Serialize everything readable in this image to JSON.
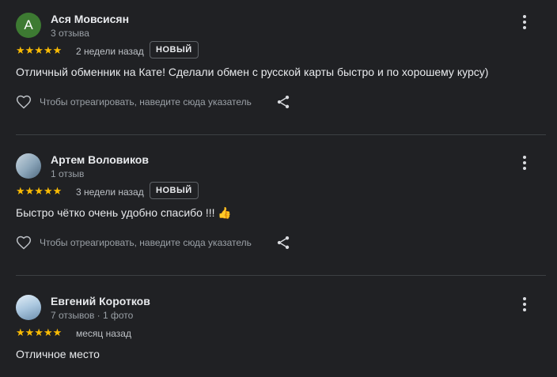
{
  "reviews": [
    {
      "author": "Ася Мовсисян",
      "avatar_letter": "A",
      "meta": "3 отзыва",
      "stars": "★★★★★",
      "when": "2 недели назад",
      "badge": "НОВЫЙ",
      "text": "Отличный обменник на Кате! Сделали обмен с русской карты быстро и по хорошему курсу)",
      "react_label": "Чтобы отреагировать, наведите сюда указатель"
    },
    {
      "author": "Артем Воловиков",
      "meta": "1 отзыв",
      "stars": "★★★★★",
      "when": "3 недели назад",
      "badge": "НОВЫЙ",
      "text": "Быстро чётко очень удобно спасибо !!! 👍",
      "react_label": "Чтобы отреагировать, наведите сюда указатель"
    },
    {
      "author": "Евгений Коротков",
      "meta": "7 отзывов · 1 фото",
      "stars": "★★★★★",
      "when": "месяц назад",
      "text": "Отличное место"
    }
  ],
  "colors": {
    "background": "#202124",
    "star": "#fbbc04",
    "avatar_green": "#3d7a32"
  }
}
